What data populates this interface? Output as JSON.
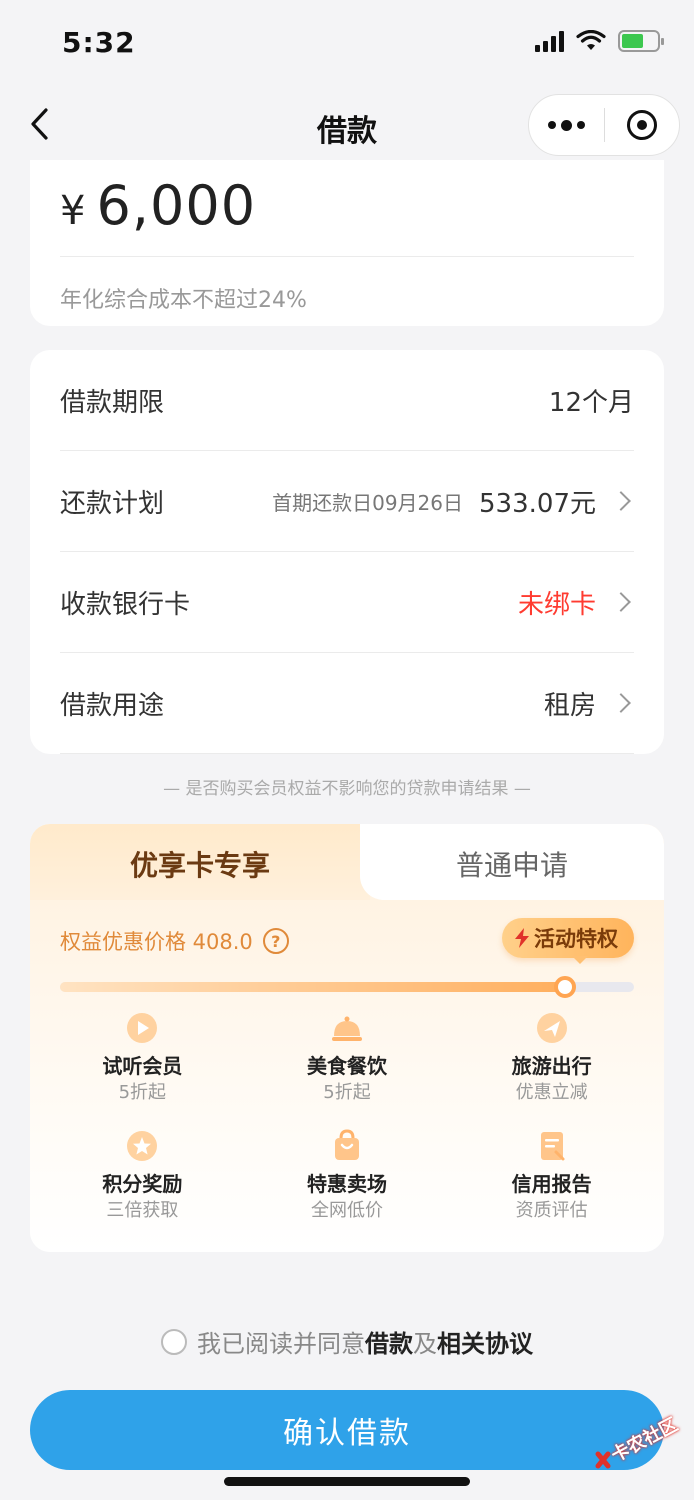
{
  "status_bar": {
    "time": "5:32"
  },
  "nav": {
    "title": "借款"
  },
  "amount_card": {
    "currency": "¥",
    "amount": "6,000",
    "note": "年化综合成本不超过24%"
  },
  "details": {
    "term": {
      "label": "借款期限",
      "value": "12个月"
    },
    "plan": {
      "label": "还款计划",
      "sub": "首期还款日09月26日",
      "value": "533.07元"
    },
    "card": {
      "label": "收款银行卡",
      "value": "未绑卡"
    },
    "purpose": {
      "label": "借款用途",
      "value": "租房"
    }
  },
  "notice": "— 是否购买会员权益不影响您的贷款申请结果 —",
  "membership": {
    "tab_active": "优享卡专享",
    "tab_inactive": "普通申请",
    "price_label": "权益优惠价格 408.0",
    "help": "?",
    "promo": "活动特权",
    "progress": 0.879,
    "benefits": [
      {
        "icon": "play-icon",
        "title": "试听会员",
        "sub": "5折起"
      },
      {
        "icon": "food-dome-icon",
        "title": "美食餐饮",
        "sub": "5折起"
      },
      {
        "icon": "plane-icon",
        "title": "旅游出行",
        "sub": "优惠立减"
      },
      {
        "icon": "star-badge-icon",
        "title": "积分奖励",
        "sub": "三倍获取"
      },
      {
        "icon": "shopping-bag-icon",
        "title": "特惠卖场",
        "sub": "全网低价"
      },
      {
        "icon": "report-icon",
        "title": "信用报告",
        "sub": "资质评估"
      }
    ]
  },
  "agreement": {
    "prefix": "我已阅读并同意",
    "link1": "借款",
    "mid": "及",
    "link2": "相关协议"
  },
  "confirm": {
    "label": "确认借款"
  },
  "watermark": {
    "text": "卡农社区"
  },
  "colors": {
    "primary": "#2fa2e9",
    "warning": "#ff3b30",
    "accent": "#e08a3a"
  }
}
